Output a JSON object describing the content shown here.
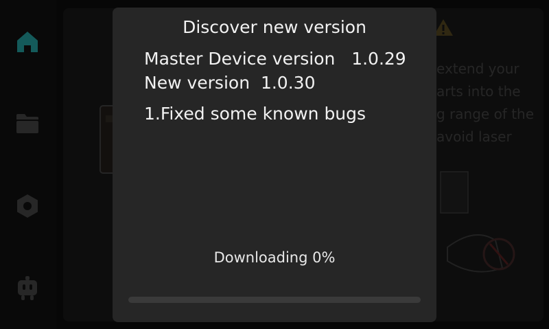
{
  "sidebar": {
    "items": [
      {
        "icon": "home-icon",
        "color": "#1f8a8a"
      },
      {
        "icon": "folder-icon",
        "color": "#3c3c3c"
      },
      {
        "icon": "settings-icon",
        "color": "#3c3c3c"
      },
      {
        "icon": "robot-icon",
        "color": "#3c3c3c"
      }
    ]
  },
  "background": {
    "warning_lines": [
      "extend your",
      "arts into the",
      "g range of the",
      "avoid laser"
    ]
  },
  "dialog": {
    "title": "Discover new version",
    "master_label": "Master Device version",
    "master_version": "1.0.29",
    "new_label": "New version",
    "new_version": "1.0.30",
    "changelog": [
      "1.Fixed some known bugs"
    ],
    "status_text": "Downloading 0%",
    "progress": 0
  }
}
